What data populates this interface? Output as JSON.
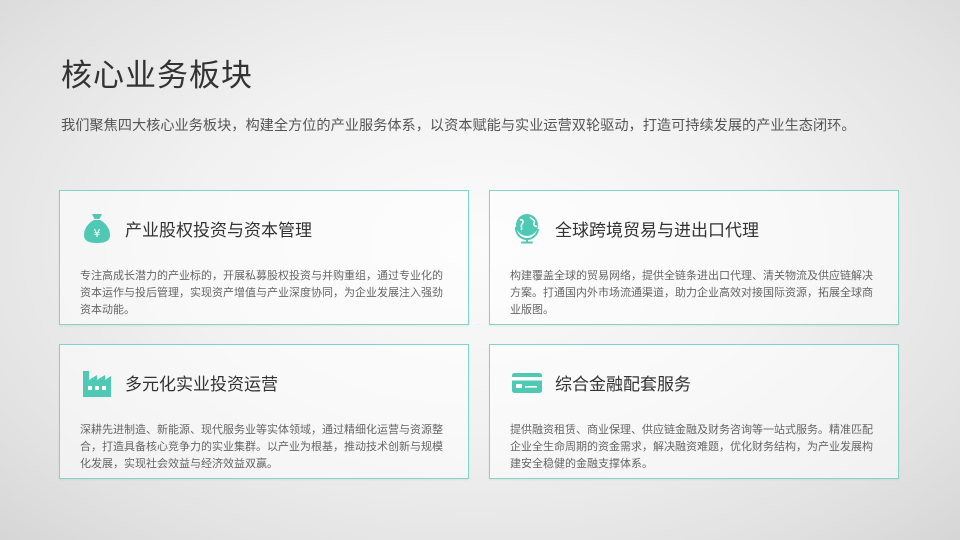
{
  "title": "核心业务板块",
  "intro": "我们聚焦四大核心业务板块，构建全方位的产业服务体系，以资本赋能与实业运营双轮驱动，打造可持续发展的产业生态闭环。",
  "colors": {
    "accent": "#4fc8b4",
    "border": "#7fd6c6"
  },
  "cards": [
    {
      "icon": "money-bag-icon",
      "title": "产业股权投资与资本管理",
      "desc": "专注高成长潜力的产业标的，开展私募股权投资与并购重组，通过专业化的资本运作与投后管理，实现资产增值与产业深度协同，为企业发展注入强劲资本动能。"
    },
    {
      "icon": "globe-icon",
      "title": "全球跨境贸易与进出口代理",
      "desc": "构建覆盖全球的贸易网络，提供全链条进出口代理、清关物流及供应链解决方案。打通国内外市场流通渠道，助力企业高效对接国际资源，拓展全球商业版图。"
    },
    {
      "icon": "factory-icon",
      "title": "多元化实业投资运营",
      "desc": "深耕先进制造、新能源、现代服务业等实体领域，通过精细化运营与资源整合，打造具备核心竞争力的实业集群。以产业为根基，推动技术创新与规模化发展，实现社会效益与经济效益双赢。"
    },
    {
      "icon": "credit-card-icon",
      "title": "综合金融配套服务",
      "desc": "提供融资租赁、商业保理、供应链金融及财务咨询等一站式服务。精准匹配企业全生命周期的资金需求，解决融资难题，优化财务结构，为产业发展构建安全稳健的金融支撑体系。"
    }
  ]
}
